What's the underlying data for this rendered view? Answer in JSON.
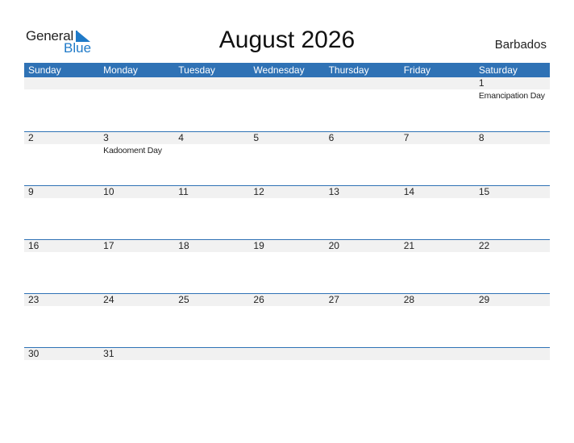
{
  "logo": {
    "line1": "General",
    "line2": "Blue",
    "brand_color": "#1f7ac8"
  },
  "header": {
    "title": "August 2026",
    "country": "Barbados"
  },
  "colors": {
    "header_bg": "#2f72b5",
    "date_bar_bg": "#f1f1f1"
  },
  "weekdays": [
    "Sunday",
    "Monday",
    "Tuesday",
    "Wednesday",
    "Thursday",
    "Friday",
    "Saturday"
  ],
  "weeks": [
    {
      "days": [
        "",
        "",
        "",
        "",
        "",
        "",
        "1"
      ],
      "events": [
        "",
        "",
        "",
        "",
        "",
        "",
        "Emancipation Day"
      ]
    },
    {
      "days": [
        "2",
        "3",
        "4",
        "5",
        "6",
        "7",
        "8"
      ],
      "events": [
        "",
        "Kadooment Day",
        "",
        "",
        "",
        "",
        ""
      ]
    },
    {
      "days": [
        "9",
        "10",
        "11",
        "12",
        "13",
        "14",
        "15"
      ],
      "events": [
        "",
        "",
        "",
        "",
        "",
        "",
        ""
      ]
    },
    {
      "days": [
        "16",
        "17",
        "18",
        "19",
        "20",
        "21",
        "22"
      ],
      "events": [
        "",
        "",
        "",
        "",
        "",
        "",
        ""
      ]
    },
    {
      "days": [
        "23",
        "24",
        "25",
        "26",
        "27",
        "28",
        "29"
      ],
      "events": [
        "",
        "",
        "",
        "",
        "",
        "",
        ""
      ]
    },
    {
      "days": [
        "30",
        "31",
        "",
        "",
        "",
        "",
        ""
      ],
      "events": [
        "",
        "",
        "",
        "",
        "",
        "",
        ""
      ]
    }
  ]
}
